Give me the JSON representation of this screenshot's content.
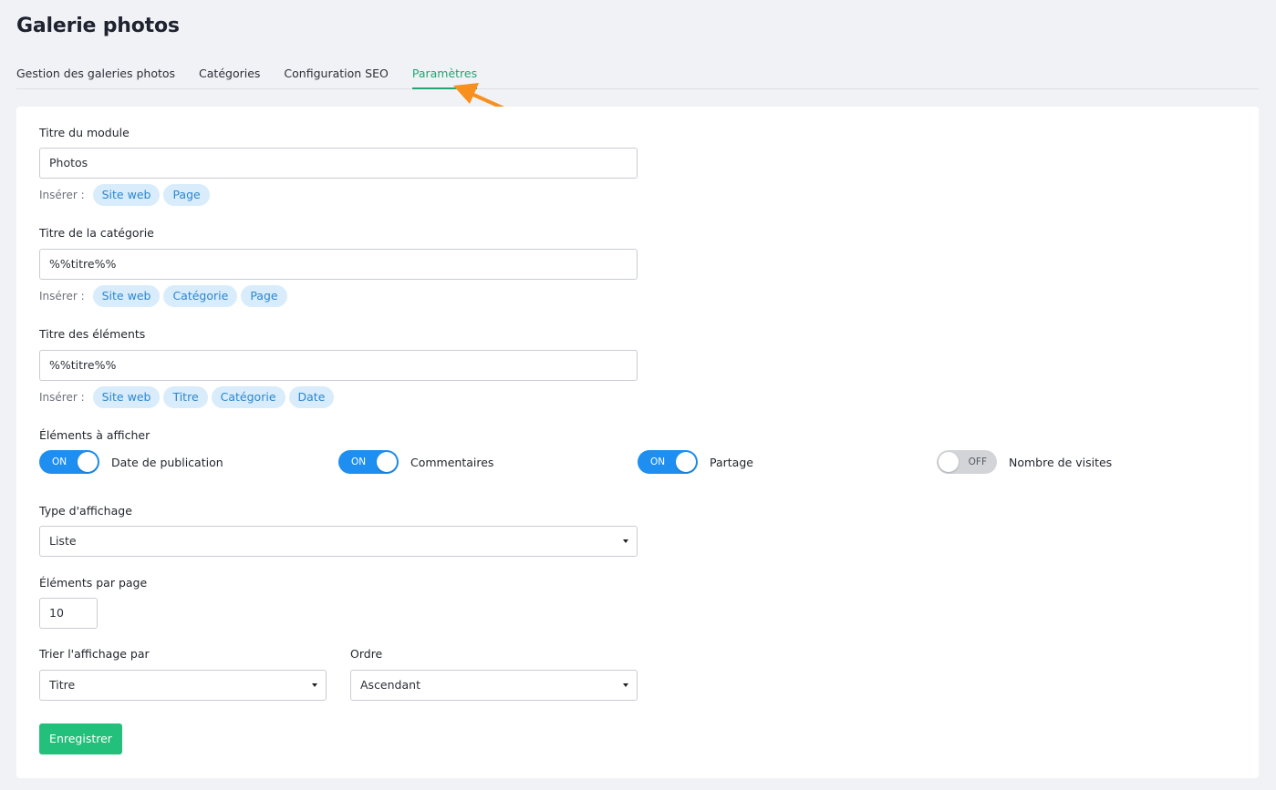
{
  "page": {
    "title": "Galerie photos"
  },
  "tabs": [
    {
      "label": "Gestion des galeries photos"
    },
    {
      "label": "Catégories"
    },
    {
      "label": "Configuration SEO"
    },
    {
      "label": "Paramètres",
      "active": true
    }
  ],
  "insert_label": "Insérer :",
  "module_title": {
    "label": "Titre du module",
    "value": "Photos",
    "chips": [
      "Site web",
      "Page"
    ]
  },
  "category_title": {
    "label": "Titre de la catégorie",
    "value": "%%titre%%",
    "chips": [
      "Site web",
      "Catégorie",
      "Page"
    ]
  },
  "elements_title": {
    "label": "Titre des éléments",
    "value": "%%titre%%",
    "chips": [
      "Site web",
      "Titre",
      "Catégorie",
      "Date"
    ]
  },
  "display_elements": {
    "label": "Éléments à afficher",
    "toggles": [
      {
        "state": "ON",
        "label": "Date de publication"
      },
      {
        "state": "ON",
        "label": "Commentaires"
      },
      {
        "state": "ON",
        "label": "Partage"
      },
      {
        "state": "OFF",
        "label": "Nombre de visites"
      }
    ]
  },
  "display_type": {
    "label": "Type d'affichage",
    "value": "Liste"
  },
  "per_page": {
    "label": "Éléments par page",
    "value": "10"
  },
  "sort_by": {
    "label": "Trier l'affichage par",
    "value": "Titre"
  },
  "order": {
    "label": "Ordre",
    "value": "Ascendant"
  },
  "save_label": "Enregistrer",
  "colors": {
    "accent_green": "#1fa671",
    "toggle_blue": "#1e8ff0",
    "chip_bg": "#d8ecfb",
    "chip_text": "#2c87d0",
    "button_green": "#22c07a",
    "arrow_orange": "#f7901e"
  }
}
